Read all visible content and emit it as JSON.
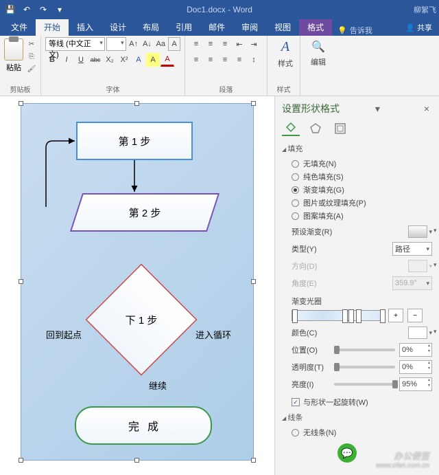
{
  "title": {
    "doc": "Doc1.docx - Word",
    "user": "柳絮飞"
  },
  "qat": {
    "save": "💾",
    "undo": "↶",
    "redo": "↷",
    "touch": "☐"
  },
  "tabs": {
    "file": "文件",
    "home": "开始",
    "insert": "插入",
    "design": "设计",
    "layout": "布局",
    "references": "引用",
    "mailings": "邮件",
    "review": "审阅",
    "view": "视图",
    "format": "格式",
    "tellme": "告诉我",
    "share": "共享"
  },
  "ribbon": {
    "clipboard": {
      "label": "剪贴板",
      "paste": "粘贴"
    },
    "font": {
      "label": "字体",
      "name": "等线 (中文正文)",
      "size": "",
      "grow": "A",
      "shrink": "A",
      "case": "Aa",
      "clear": "A",
      "bold": "B",
      "italic": "I",
      "underline": "U",
      "strike": "abc",
      "sub": "X₂",
      "sup": "X²",
      "effects": "A",
      "highlight": "A",
      "color": "A"
    },
    "paragraph": {
      "label": "段落"
    },
    "styles": {
      "label": "样式",
      "btn": "样式",
      "glyph": "A"
    },
    "editing": {
      "btn": "编辑"
    }
  },
  "flow": {
    "step1": "第 1 步",
    "step2": "第 2 步",
    "step3": "下 1 步",
    "done": "完成",
    "back": "回到起点",
    "loop": "进入循环",
    "cont": "继续"
  },
  "pane": {
    "title": "设置形状格式",
    "section_fill": "填充",
    "fill_none": "无填充(N)",
    "fill_solid": "纯色填充(S)",
    "fill_grad": "渐变填充(G)",
    "fill_pic": "图片或纹理填充(P)",
    "fill_pat": "图案填充(A)",
    "preset": "预设渐变(R)",
    "type": "类型(Y)",
    "type_val": "路径",
    "direction": "方向(D)",
    "angle": "角度(E)",
    "angle_val": "359.9°",
    "stops": "渐变光圈",
    "color": "颜色(C)",
    "position": "位置(O)",
    "position_val": "0%",
    "transparency": "透明度(T)",
    "transparency_val": "0%",
    "brightness": "亮度(I)",
    "brightness_val": "95%",
    "rotate": "与形状一起旋转(W)",
    "section_line": "线条",
    "line_none": "无线条(N)"
  },
  "watermark": {
    "name": "办公便签",
    "url": "www.cfan.com.cn"
  }
}
